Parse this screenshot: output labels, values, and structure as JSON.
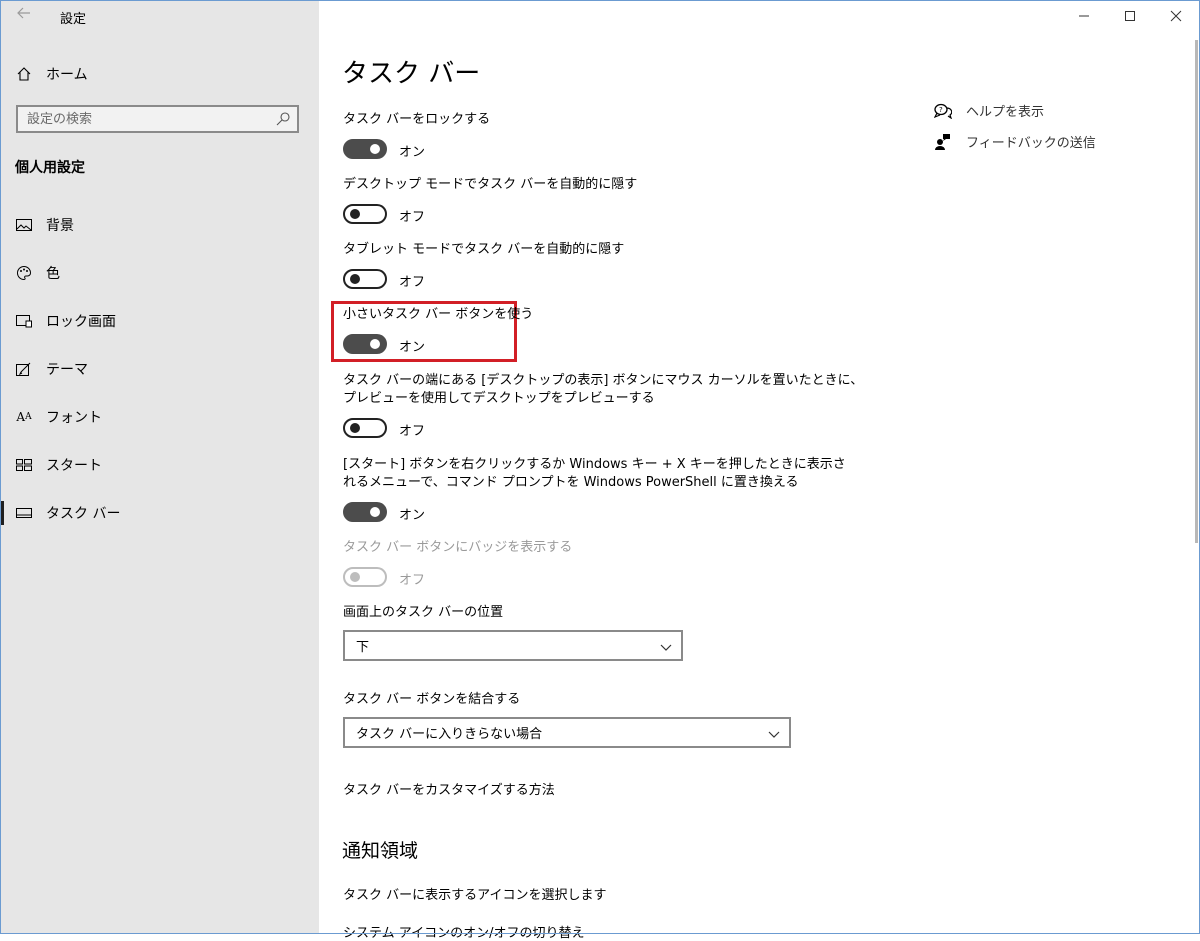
{
  "window": {
    "title": "設定",
    "controls": [
      "minimize",
      "maximize",
      "close"
    ]
  },
  "sidebar": {
    "home_label": "ホーム",
    "search_placeholder": "設定の検索",
    "section_title": "個人用設定",
    "items": [
      {
        "label": "背景",
        "icon": "picture-icon"
      },
      {
        "label": "色",
        "icon": "palette-icon"
      },
      {
        "label": "ロック画面",
        "icon": "lock-screen-icon"
      },
      {
        "label": "テーマ",
        "icon": "theme-icon"
      },
      {
        "label": "フォント",
        "icon": "font-icon"
      },
      {
        "label": "スタート",
        "icon": "start-icon"
      },
      {
        "label": "タスク バー",
        "icon": "taskbar-icon",
        "active": true
      }
    ]
  },
  "main": {
    "title": "タスク バー",
    "settings": [
      {
        "label": "タスク バーをロックする",
        "state": "オン",
        "on": true
      },
      {
        "label": "デスクトップ モードでタスク バーを自動的に隠す",
        "state": "オフ",
        "on": false
      },
      {
        "label": "タブレット モードでタスク バーを自動的に隠す",
        "state": "オフ",
        "on": false
      },
      {
        "label": "小さいタスク バー ボタンを使う",
        "state": "オン",
        "on": true,
        "highlighted": true
      },
      {
        "label_line1": "タスク バーの端にある [デスクトップの表示] ボタンにマウス カーソルを置いたときに、",
        "label_line2": "プレビューを使用してデスクトップをプレビューする",
        "state": "オフ",
        "on": false
      },
      {
        "label_line1": "[スタート] ボタンを右クリックするか Windows キー + X キーを押したときに表示さ",
        "label_line2": "れるメニューで、コマンド プロンプトを Windows PowerShell に置き換える",
        "state": "オン",
        "on": true
      },
      {
        "label": "タスク バー ボタンにバッジを表示する",
        "state": "オフ",
        "on": false,
        "disabled": true
      }
    ],
    "position": {
      "label": "画面上のタスク バーの位置",
      "value": "下"
    },
    "combine": {
      "label": "タスク バー ボタンを結合する",
      "value": "タスク バーに入りきらない場合"
    },
    "customize_link": "タスク バーをカスタマイズする方法",
    "notification_heading": "通知領域",
    "notification_links": [
      "タスク バーに表示するアイコンを選択します",
      "システム アイコンのオン/オフの切り替え"
    ]
  },
  "help": {
    "show_help": "ヘルプを表示",
    "feedback": "フィードバックの送信"
  },
  "colors": {
    "sidebar_bg": "#e6e6e6",
    "toggle_on": "#4c4c4c",
    "highlight": "#d21f26"
  }
}
